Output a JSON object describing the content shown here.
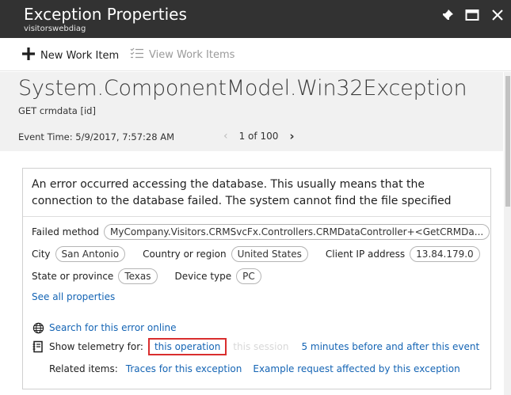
{
  "window": {
    "title": "Exception Properties",
    "subtitle": "visitorswebdiag"
  },
  "toolbar": {
    "new_work_item": "New Work Item",
    "view_work_items": "View Work Items"
  },
  "header": {
    "exception_type": "System.ComponentModel.Win32Exception",
    "request_name": "GET crmdata [id]",
    "event_time": "Event Time: 5/9/2017, 7:57:28 AM",
    "pager": "1 of 100"
  },
  "card": {
    "message": "An error occurred accessing the database. This usually means that the connection to the database failed. The system cannot find the file specified",
    "failed_method_label": "Failed method",
    "failed_method_value": "MyCompany.Visitors.CRMSvcFx.Controllers.CRMDataController+<GetCRMDa...",
    "city_label": "City",
    "city_value": "San Antonio",
    "country_label": "Country or region",
    "country_value": "United States",
    "ip_label": "Client IP address",
    "ip_value": "13.84.179.0",
    "state_label": "State or province",
    "state_value": "Texas",
    "device_label": "Device type",
    "device_value": "PC",
    "see_all": "See all properties",
    "search_online": "Search for this error online",
    "show_telemetry_label": "Show telemetry for:",
    "this_operation": "this operation",
    "this_session": "this session",
    "five_minutes": "5 minutes before and after this event",
    "related_label": "Related items:",
    "traces": "Traces for this exception",
    "example_request": "Example request affected by this exception"
  },
  "colors": {
    "titlebar": "#323232",
    "link": "#1464b4",
    "highlight_border": "#d92e2e",
    "header_bg": "#f1f1f1"
  },
  "icons": [
    "pin-icon",
    "maximize-icon",
    "close-icon",
    "plus-icon",
    "list-check-icon",
    "globe-icon",
    "document-icon",
    "chevron-left-icon",
    "chevron-right-icon"
  ]
}
